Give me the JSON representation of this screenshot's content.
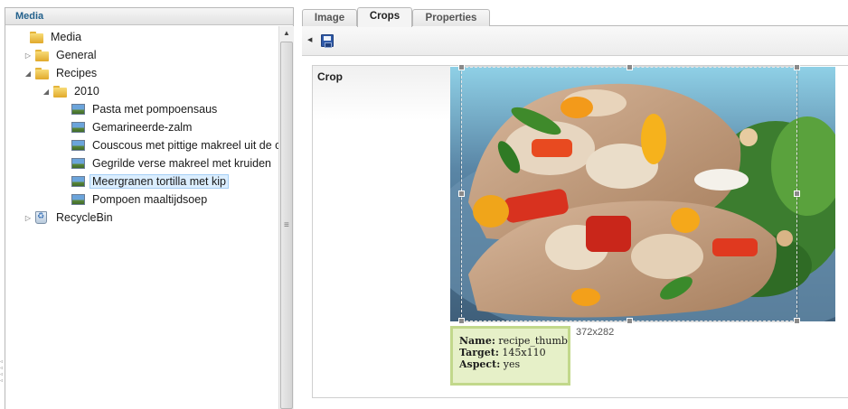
{
  "media_panel": {
    "title": "Media",
    "tree": [
      {
        "label": "Media",
        "type": "folder",
        "level": 0,
        "expanded": true
      },
      {
        "label": "General",
        "type": "folder",
        "level": 1,
        "expanded": false
      },
      {
        "label": "Recipes",
        "type": "folder",
        "level": 1,
        "expanded": true
      },
      {
        "label": "2010",
        "type": "folder",
        "level": 2,
        "expanded": true
      },
      {
        "label": "Pasta met pompoensaus",
        "type": "image",
        "level": 3
      },
      {
        "label": "Gemarineerde-zalm",
        "type": "image",
        "level": 3
      },
      {
        "label": "Couscous met pittige makreel uit de o",
        "type": "image",
        "level": 3
      },
      {
        "label": "Gegrilde verse makreel met kruiden",
        "type": "image",
        "level": 3
      },
      {
        "label": "Meergranen tortilla met kip",
        "type": "image",
        "level": 3,
        "selected": true
      },
      {
        "label": "Pompoen maaltijdsoep",
        "type": "image",
        "level": 3
      },
      {
        "label": "RecycleBin",
        "type": "recycle-bin",
        "level": 1,
        "expanded": false
      }
    ]
  },
  "tabs": [
    {
      "label": "Image",
      "active": false
    },
    {
      "label": "Crops",
      "active": true
    },
    {
      "label": "Properties",
      "active": false
    }
  ],
  "toolbar": {
    "icons": [
      "collapse-arrow-icon",
      "save-icon"
    ]
  },
  "crop_editor": {
    "section_label": "Crop",
    "image_alt": "chicken tortilla wrap photo",
    "crop_dimensions": "372x282",
    "info": {
      "name_label": "Name:",
      "name_value": "recipe_thumb",
      "target_label": "Target:",
      "target_value": "145x110",
      "aspect_label": "Aspect:",
      "aspect_value": "yes"
    }
  },
  "colors": {
    "header_text": "#23618c",
    "selected_bg": "#dbeeff",
    "info_bg": "#e6f0c8",
    "info_border": "#c2d88b"
  }
}
